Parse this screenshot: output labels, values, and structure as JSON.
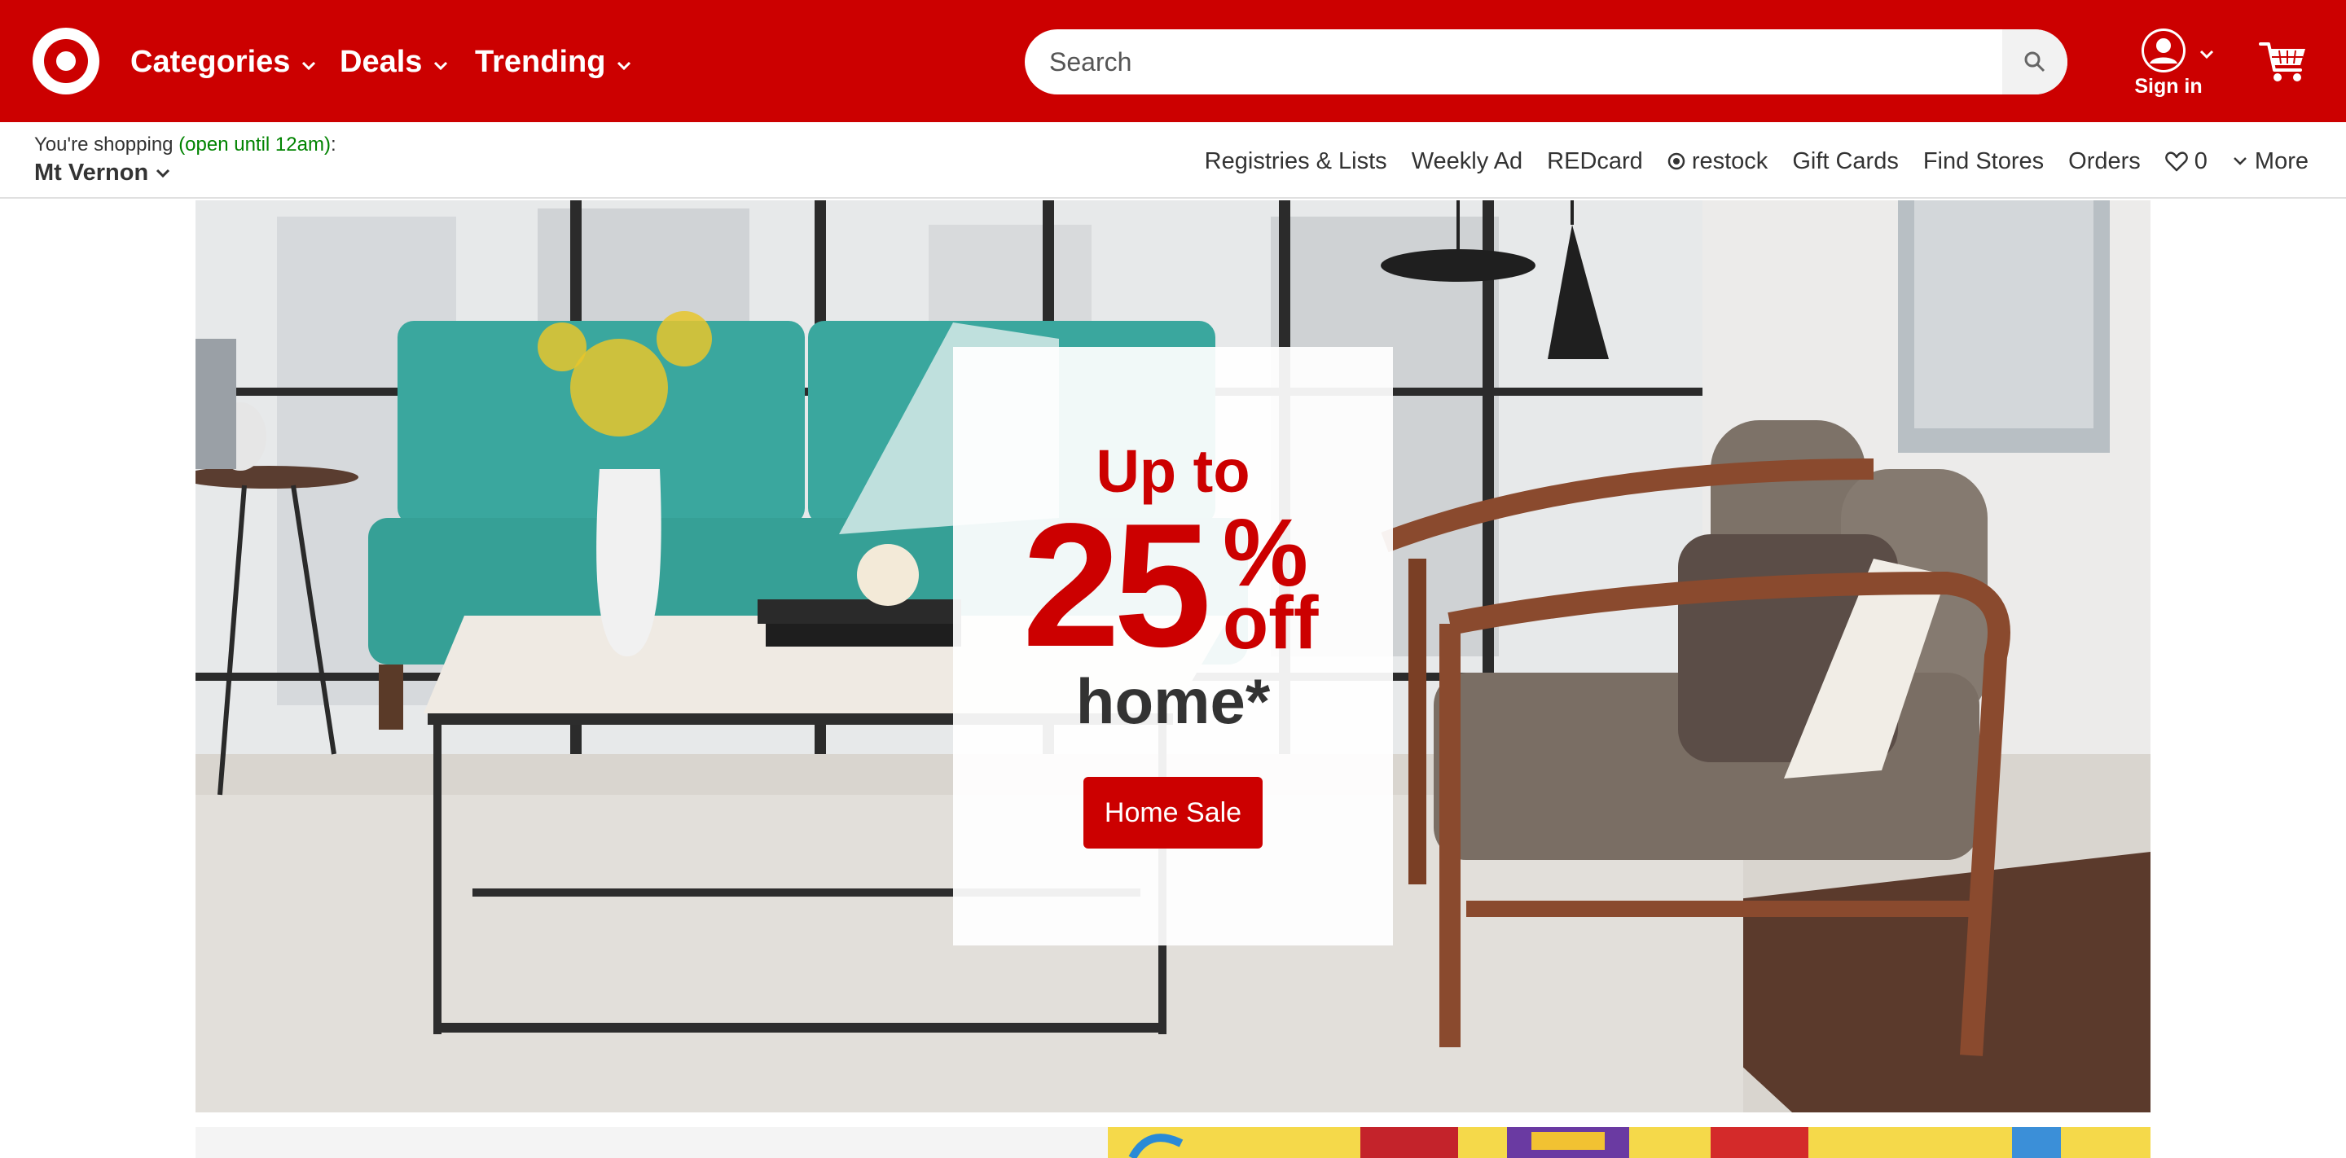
{
  "header": {
    "logo": "target-bullseye-logo",
    "nav": [
      {
        "label": "Categories"
      },
      {
        "label": "Deals"
      },
      {
        "label": "Trending"
      }
    ],
    "search": {
      "placeholder": "Search",
      "value": ""
    },
    "account": {
      "label": "Sign in"
    },
    "colors": {
      "brand": "#cc0000",
      "text_on_brand": "#ffffff"
    }
  },
  "subheader": {
    "shopping_prefix": "You're shopping ",
    "open_status": "(open until 12am)",
    "shopping_suffix": ":",
    "store_name": "Mt Vernon",
    "links": {
      "registries": "Registries & Lists",
      "weekly_ad": "Weekly Ad",
      "redcard": "REDcard",
      "restock": "restock",
      "gift_cards": "Gift Cards",
      "find_stores": "Find Stores",
      "orders": "Orders",
      "favorites_count": "0",
      "more": "More"
    },
    "colors": {
      "open_status": "#008300"
    }
  },
  "hero": {
    "line1": "Up to",
    "number": "25",
    "percent": "%",
    "off": "off",
    "line3": "home*",
    "cta": "Home Sale"
  }
}
